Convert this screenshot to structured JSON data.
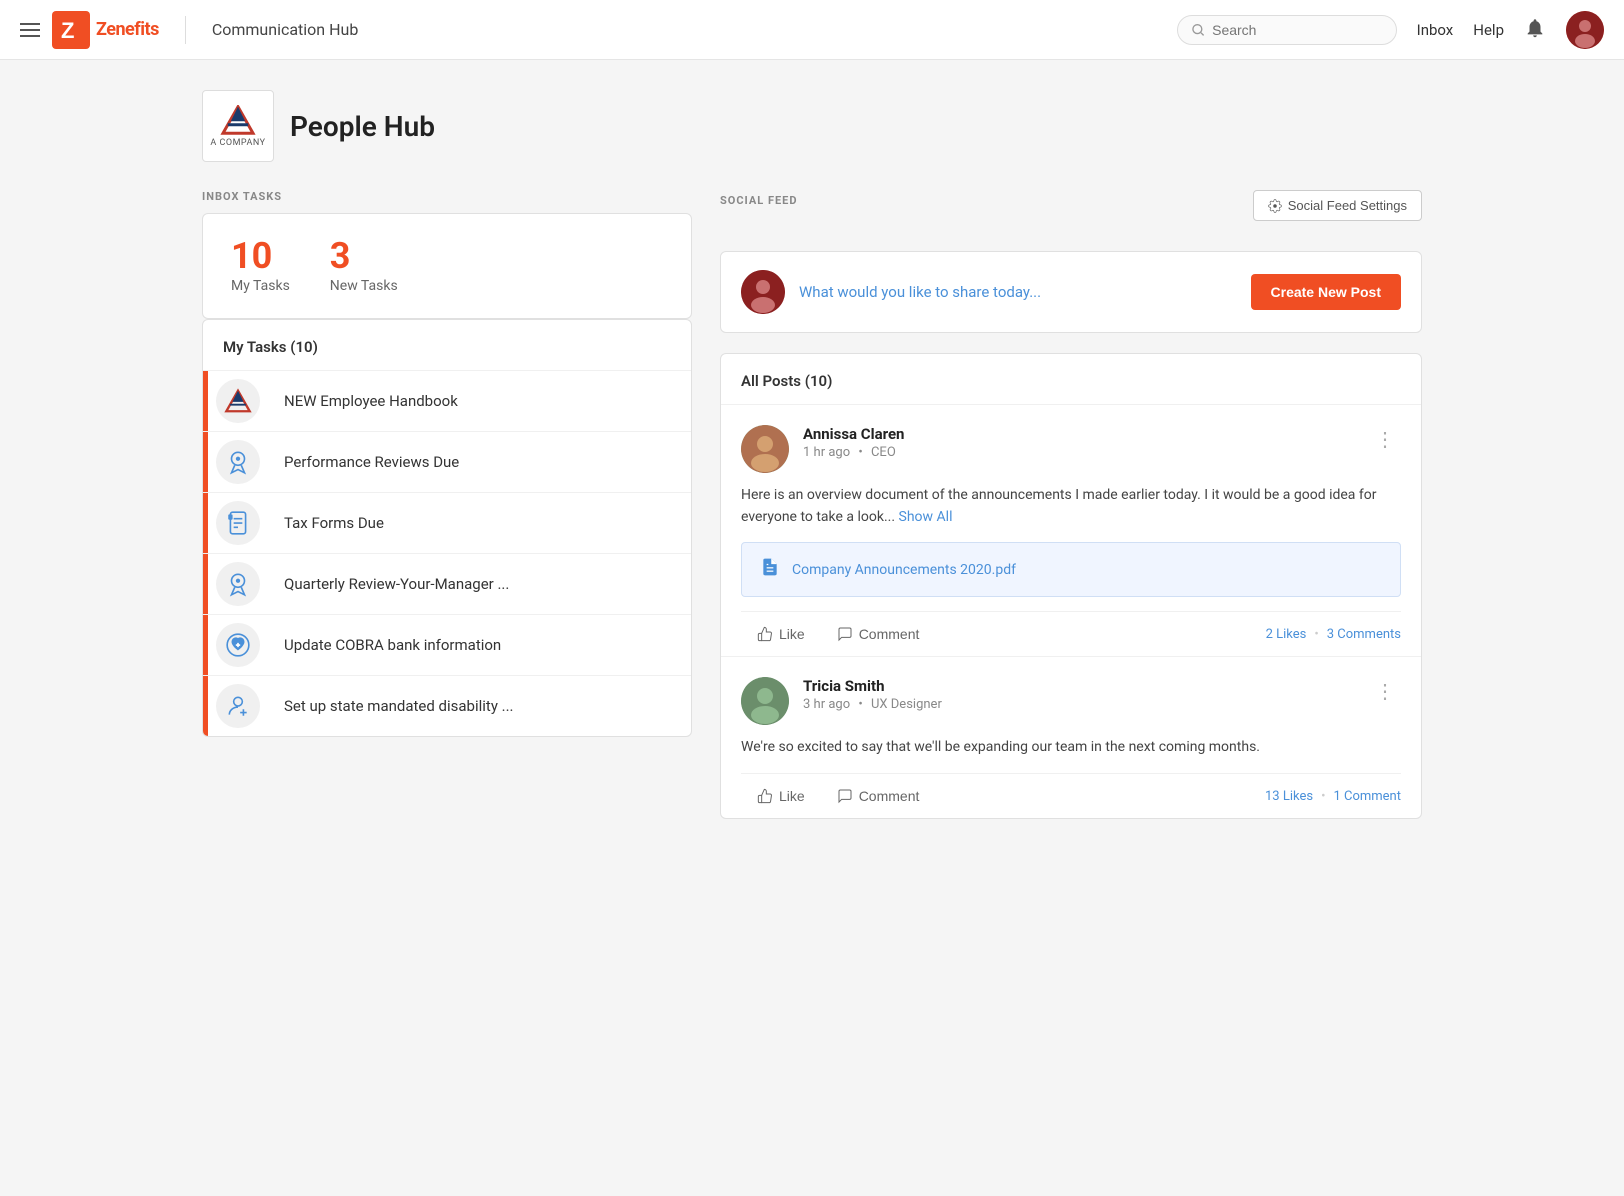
{
  "topnav": {
    "app_name": "Zenefits",
    "page_title": "Communication Hub",
    "search_placeholder": "Search",
    "inbox_label": "Inbox",
    "help_label": "Help"
  },
  "people_hub": {
    "title": "People Hub",
    "company_name": "A COMPANY"
  },
  "inbox_tasks": {
    "section_label": "INBOX TASKS",
    "my_tasks_count": "10",
    "my_tasks_label": "My Tasks",
    "new_tasks_count": "3",
    "new_tasks_label": "New Tasks",
    "my_tasks_heading": "My Tasks (10)",
    "tasks": [
      {
        "id": 1,
        "label": "NEW Employee Handbook",
        "icon": "company"
      },
      {
        "id": 2,
        "label": "Performance Reviews Due",
        "icon": "award"
      },
      {
        "id": 3,
        "label": "Tax Forms Due",
        "icon": "document"
      },
      {
        "id": 4,
        "label": "Quarterly Review-Your-Manager ...",
        "icon": "award"
      },
      {
        "id": 5,
        "label": "Update COBRA bank information",
        "icon": "heart"
      },
      {
        "id": 6,
        "label": "Set up state mandated disability ...",
        "icon": "person-plus"
      }
    ]
  },
  "social_feed": {
    "section_label": "SOCIAL FEED",
    "settings_btn_label": "Social Feed Settings",
    "new_post_placeholder": "What would you like to share today...",
    "create_post_label": "Create New Post",
    "all_posts_heading": "All Posts (10)",
    "posts": [
      {
        "id": 1,
        "author": "Annissa Claren",
        "time_ago": "1 hr ago",
        "role": "CEO",
        "body": "Here is an overview document of the announcements I made earlier today. I it would be a good idea for everyone to take a look...",
        "show_all": "Show All",
        "attachment": "Company Announcements 2020.pdf",
        "likes_count": "2 Likes",
        "comments_count": "3 Comments",
        "like_label": "Like",
        "comment_label": "Comment"
      },
      {
        "id": 2,
        "author": "Tricia Smith",
        "time_ago": "3 hr ago",
        "role": "UX Designer",
        "body": "We're so excited to say that we'll be expanding our team in the next coming months.",
        "show_all": "",
        "attachment": "",
        "likes_count": "13 Likes",
        "comments_count": "1 Comment",
        "like_label": "Like",
        "comment_label": "Comment"
      }
    ]
  }
}
